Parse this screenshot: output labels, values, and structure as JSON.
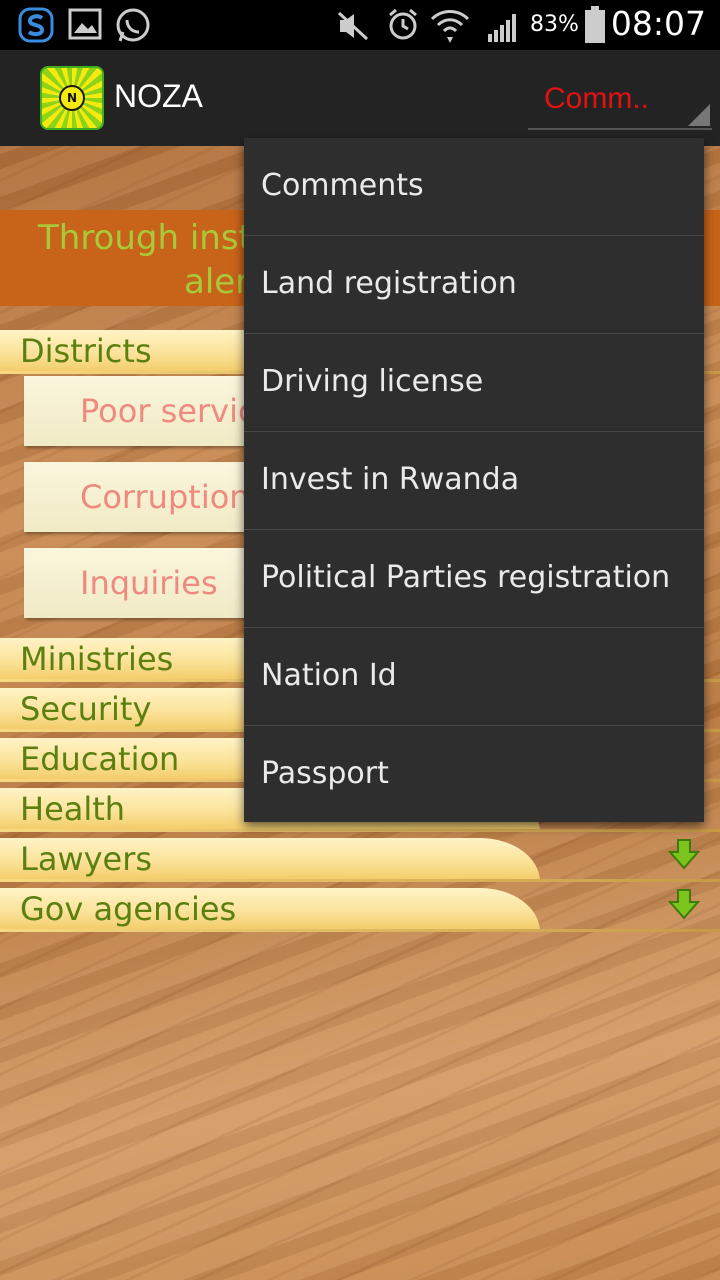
{
  "status_bar": {
    "battery_percent": "83%",
    "time": "08:07",
    "icons": [
      "s-app-icon",
      "gallery-icon",
      "whatsapp-icon",
      "mute-icon",
      "alarm-icon",
      "wifi-icon",
      "signal-icon",
      "battery-icon"
    ]
  },
  "action_bar": {
    "logo_letter": "N",
    "title": "NOZA",
    "spinner_value": "Comm.."
  },
  "banner": {
    "line1": "Through inst",
    "line2": "aler"
  },
  "categories": [
    {
      "label": "Districts"
    },
    {
      "label": "Ministries"
    },
    {
      "label": "Security"
    },
    {
      "label": "Education"
    },
    {
      "label": "Health"
    },
    {
      "label": "Lawyers"
    },
    {
      "label": "Gov agencies"
    }
  ],
  "subitems": [
    {
      "label": "Poor servic"
    },
    {
      "label": "Corruption"
    },
    {
      "label": "Inquiries"
    }
  ],
  "dropdown": {
    "items": [
      {
        "label": "Comments"
      },
      {
        "label": "Land registration"
      },
      {
        "label": "Driving license"
      },
      {
        "label": "Invest in Rwanda"
      },
      {
        "label": "Political Parties registration"
      },
      {
        "label": "Nation Id"
      },
      {
        "label": "Passport"
      }
    ]
  },
  "colors": {
    "spinner_text": "#e31212",
    "category_text": "#5b7f10",
    "subitem_text": "#ee8a80",
    "banner_bg": "#c8631a",
    "banner_text": "#a9c93b"
  }
}
